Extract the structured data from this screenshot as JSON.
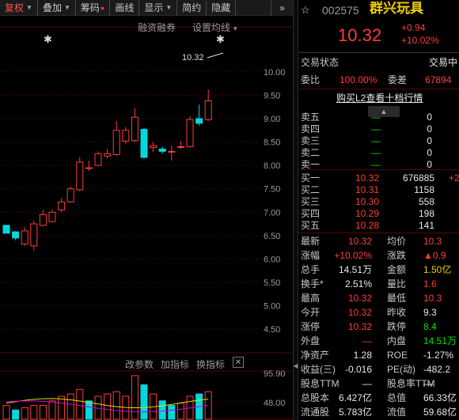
{
  "toolbar": {
    "buttons": [
      {
        "label": "复权",
        "has_caret": true,
        "active": true
      },
      {
        "label": "叠加",
        "has_caret": true,
        "active": false
      },
      {
        "label": "筹码",
        "has_dot": true,
        "active": false
      },
      {
        "label": "画线",
        "active": false
      },
      {
        "label": "显示",
        "has_caret": true,
        "active": false
      },
      {
        "label": "简约",
        "active": false
      },
      {
        "label": "隐藏",
        "active": false
      }
    ],
    "more_label": "»"
  },
  "chart": {
    "link_margin": "融资融券",
    "link_ma": "设置均线",
    "ma_caret": "▾",
    "last_price_tag": "10.32",
    "price_labels": [
      "10.00",
      "9.50",
      "9.00",
      "8.50",
      "8.00",
      "7.50",
      "7.00",
      "6.50",
      "6.00",
      "5.50",
      "5.00",
      "4.50"
    ],
    "sub_buttons": [
      "改参数",
      "加指标",
      "换指标"
    ],
    "sub_close": "✕",
    "sub_labels": [
      "95.90",
      "48.00"
    ],
    "colors": {
      "up": "#ff3b3b",
      "down": "#00d8e0",
      "grid": "#7a0000"
    }
  },
  "chart_data": {
    "type": "candlestick",
    "candles": [
      {
        "o": 6.72,
        "c": 6.55,
        "h": 6.72,
        "l": 6.55
      },
      {
        "o": 6.58,
        "c": 6.45,
        "h": 6.6,
        "l": 6.4
      },
      {
        "o": 6.32,
        "c": 6.6,
        "h": 6.68,
        "l": 6.28
      },
      {
        "o": 6.28,
        "c": 6.75,
        "h": 6.82,
        "l": 6.18
      },
      {
        "o": 6.72,
        "c": 6.95,
        "h": 7.05,
        "l": 6.7
      },
      {
        "o": 6.8,
        "c": 7.0,
        "h": 7.05,
        "l": 6.78
      },
      {
        "o": 7.05,
        "c": 7.22,
        "h": 7.3,
        "l": 7.0
      },
      {
        "o": 7.22,
        "c": 7.5,
        "h": 7.55,
        "l": 7.2
      },
      {
        "o": 7.48,
        "c": 8.07,
        "h": 8.18,
        "l": 7.45
      },
      {
        "o": 7.95,
        "c": 7.95,
        "h": 8.1,
        "l": 7.88
      },
      {
        "o": 8.0,
        "c": 8.25,
        "h": 8.3,
        "l": 7.98
      },
      {
        "o": 8.2,
        "c": 8.25,
        "h": 8.35,
        "l": 8.15
      },
      {
        "o": 8.23,
        "c": 8.75,
        "h": 8.95,
        "l": 8.2
      },
      {
        "o": 8.52,
        "c": 8.75,
        "h": 8.82,
        "l": 8.45
      },
      {
        "o": 8.53,
        "c": 9.03,
        "h": 9.22,
        "l": 8.5
      },
      {
        "o": 8.77,
        "c": 8.17,
        "h": 8.8,
        "l": 8.15
      },
      {
        "o": 8.38,
        "c": 8.42,
        "h": 8.5,
        "l": 8.28
      },
      {
        "o": 8.35,
        "c": 8.3,
        "h": 8.4,
        "l": 8.25
      },
      {
        "o": 8.3,
        "c": 8.3,
        "h": 8.42,
        "l": 8.1
      },
      {
        "o": 8.4,
        "c": 8.4,
        "h": 8.52,
        "l": 8.35
      },
      {
        "o": 8.4,
        "c": 8.98,
        "h": 9.05,
        "l": 8.38
      },
      {
        "o": 9.0,
        "c": 8.9,
        "h": 9.3,
        "l": 8.85
      },
      {
        "o": 8.98,
        "c": 9.38,
        "h": 9.62,
        "l": 8.95
      }
    ],
    "volumes": [
      0.3,
      0.2,
      0.25,
      0.3,
      0.3,
      0.4,
      0.5,
      0.55,
      0.65,
      0.4,
      0.5,
      0.55,
      0.6,
      0.5,
      0.95,
      0.75,
      0.55,
      0.4,
      0.3,
      0.35,
      0.5,
      0.55,
      0.6
    ],
    "volume_colors": [
      "up",
      "down",
      "up",
      "up",
      "up",
      "up",
      "up",
      "up",
      "up",
      "down",
      "up",
      "up",
      "up",
      "up",
      "up",
      "down",
      "up",
      "down",
      "down",
      "up",
      "up",
      "down",
      "up"
    ],
    "ylim": [
      4.3,
      10.25
    ]
  },
  "quote": {
    "code": "002575",
    "name": "群兴玩具",
    "price": "10.32",
    "change": "+0.94",
    "change_pct": "+10.02%",
    "status_label": "交易状态",
    "status_value": "交易中",
    "ratio_label": "委比",
    "ratio_value": "100.00%",
    "diff_label": "委差",
    "diff_value": "67894",
    "l2_link": "购买L2查看十档行情",
    "asks": [
      {
        "label": "卖五",
        "price": "—",
        "vol": "0"
      },
      {
        "label": "卖四",
        "price": "—",
        "vol": "0"
      },
      {
        "label": "卖三",
        "price": "—",
        "vol": "0"
      },
      {
        "label": "卖二",
        "price": "—",
        "vol": "0"
      },
      {
        "label": "卖一",
        "price": "—",
        "vol": "0"
      }
    ],
    "bids": [
      {
        "label": "买一",
        "price": "10.32",
        "vol": "676885",
        "extra": "+2"
      },
      {
        "label": "买二",
        "price": "10.31",
        "vol": "1158",
        "extra": ""
      },
      {
        "label": "买三",
        "price": "10.30",
        "vol": "558",
        "extra": ""
      },
      {
        "label": "买四",
        "price": "10.29",
        "vol": "198",
        "extra": ""
      },
      {
        "label": "买五",
        "price": "10.28",
        "vol": "141",
        "extra": ""
      }
    ],
    "stats": [
      {
        "l1": "最新",
        "v1": "10.32",
        "c1": "red",
        "l2": "均价",
        "v2": "10.3",
        "c2": "red"
      },
      {
        "l1": "涨幅",
        "v1": "+10.02%",
        "c1": "red",
        "l2": "涨跌",
        "v2": "▲0.9",
        "c2": "red"
      },
      {
        "l1": "总手",
        "v1": "14.51万",
        "c1": "white",
        "l2": "金额",
        "v2": "1.50亿",
        "c2": "yellow"
      },
      {
        "l1": "换手*",
        "v1": "2.51%",
        "c1": "white",
        "l2": "量比",
        "v2": "1.6",
        "c2": "red"
      },
      {
        "l1": "最高",
        "v1": "10.32",
        "c1": "red",
        "l2": "最低",
        "v2": "10.3",
        "c2": "red"
      },
      {
        "l1": "今开",
        "v1": "10.32",
        "c1": "red",
        "l2": "昨收",
        "v2": "9.3",
        "c2": "white"
      },
      {
        "l1": "涨停",
        "v1": "10.32",
        "c1": "red",
        "l2": "跌停",
        "v2": "8.4",
        "c2": "green"
      },
      {
        "l1": "外盘",
        "v1": "—",
        "c1": "red",
        "l2": "内盘",
        "v2": "14.51万",
        "c2": "green"
      },
      {
        "l1": "净资产",
        "v1": "1.28",
        "c1": "white",
        "l2": "ROE",
        "v2": "-1.27%",
        "c2": "white"
      },
      {
        "l1": "收益(三)",
        "v1": "-0.016",
        "c1": "white",
        "l2": "PE(动)",
        "v2": "-482.2",
        "c2": "white"
      },
      {
        "l1": "股息TTM",
        "v1": "—",
        "c1": "white",
        "l2": "股息率TTM",
        "v2": "—",
        "c2": "white"
      },
      {
        "l1": "总股本",
        "v1": "6.427亿",
        "c1": "white",
        "l2": "总值",
        "v2": "66.33亿",
        "c2": "white"
      },
      {
        "l1": "流通股",
        "v1": "5.783亿",
        "c1": "white",
        "l2": "流值",
        "v2": "59.68亿",
        "c2": "white"
      }
    ]
  }
}
